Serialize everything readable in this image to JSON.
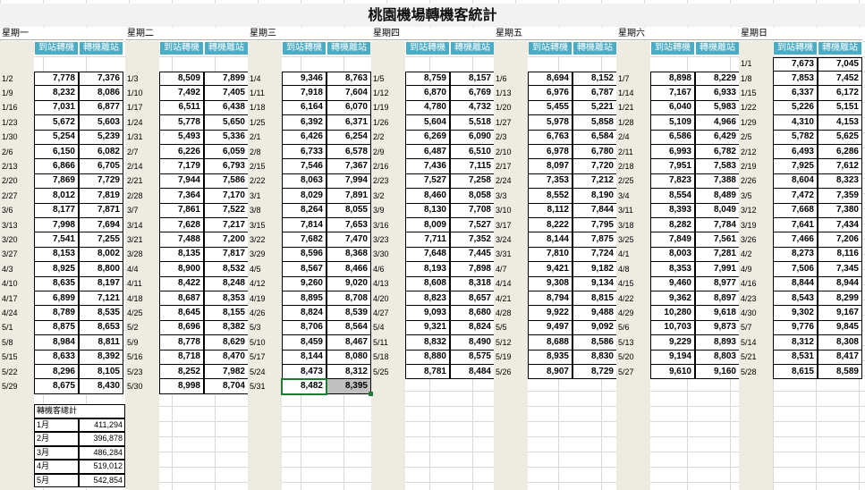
{
  "title": "桃園機場轉機客統計",
  "col_headers": {
    "arrive": "到站轉機",
    "depart": "轉機離站"
  },
  "weekdays": [
    "星期一",
    "星期二",
    "星期三",
    "星期四",
    "星期五",
    "星期六",
    "星期日"
  ],
  "extra_row": {
    "date": "1/1",
    "arrive": "7,673",
    "depart": "7,045"
  },
  "columns": [
    {
      "dates": [
        "1/2",
        "1/9",
        "1/16",
        "1/23",
        "1/30",
        "2/6",
        "2/13",
        "2/20",
        "2/27",
        "3/6",
        "3/13",
        "3/20",
        "3/27",
        "4/3",
        "4/10",
        "4/17",
        "4/24",
        "5/1",
        "5/8",
        "5/15",
        "5/22",
        "5/29"
      ],
      "arrive": [
        "7,778",
        "8,232",
        "7,031",
        "5,672",
        "5,254",
        "6,150",
        "6,866",
        "7,869",
        "8,012",
        "8,177",
        "7,998",
        "7,541",
        "8,153",
        "8,925",
        "8,635",
        "6,899",
        "8,789",
        "8,875",
        "8,984",
        "8,633",
        "8,296",
        "8,675"
      ],
      "depart": [
        "7,376",
        "8,086",
        "6,877",
        "5,603",
        "5,239",
        "6,082",
        "6,705",
        "7,729",
        "7,819",
        "7,871",
        "7,694",
        "7,255",
        "8,002",
        "8,800",
        "8,197",
        "7,121",
        "8,535",
        "8,653",
        "8,811",
        "8,392",
        "8,105",
        "8,430"
      ]
    },
    {
      "dates": [
        "1/3",
        "1/10",
        "1/17",
        "1/24",
        "1/31",
        "2/7",
        "2/14",
        "2/21",
        "2/28",
        "3/7",
        "3/14",
        "3/21",
        "3/28",
        "4/4",
        "4/11",
        "4/18",
        "4/25",
        "5/2",
        "5/9",
        "5/16",
        "5/23",
        "5/30"
      ],
      "arrive": [
        "8,509",
        "7,492",
        "6,511",
        "5,778",
        "5,493",
        "6,226",
        "7,179",
        "7,944",
        "7,364",
        "7,861",
        "7,628",
        "7,488",
        "8,135",
        "8,900",
        "8,422",
        "8,687",
        "8,645",
        "8,696",
        "8,778",
        "8,718",
        "8,252",
        "8,998"
      ],
      "depart": [
        "7,899",
        "7,405",
        "6,438",
        "5,650",
        "5,336",
        "6,059",
        "6,793",
        "7,586",
        "7,170",
        "7,522",
        "7,217",
        "7,200",
        "7,817",
        "8,532",
        "8,248",
        "8,353",
        "8,155",
        "8,382",
        "8,629",
        "8,470",
        "7,982",
        "8,704"
      ]
    },
    {
      "dates": [
        "1/4",
        "1/11",
        "1/18",
        "1/25",
        "2/1",
        "2/8",
        "2/15",
        "2/22",
        "3/1",
        "3/8",
        "3/15",
        "3/22",
        "3/29",
        "4/5",
        "4/12",
        "4/19",
        "4/26",
        "5/3",
        "5/10",
        "5/17",
        "5/24",
        "5/31"
      ],
      "arrive": [
        "9,346",
        "7,918",
        "6,164",
        "6,392",
        "6,426",
        "6,733",
        "7,546",
        "8,063",
        "8,029",
        "8,264",
        "7,814",
        "7,682",
        "8,596",
        "8,567",
        "9,260",
        "8,895",
        "8,824",
        "8,706",
        "8,459",
        "8,144",
        "8,473",
        "8,482"
      ],
      "depart": [
        "8,763",
        "7,604",
        "6,070",
        "6,371",
        "6,254",
        "6,578",
        "7,367",
        "7,994",
        "7,891",
        "8,055",
        "7,653",
        "7,470",
        "8,368",
        "8,466",
        "9,020",
        "8,708",
        "8,539",
        "8,564",
        "8,467",
        "8,080",
        "8,312",
        "8,395"
      ]
    },
    {
      "dates": [
        "1/5",
        "1/12",
        "1/19",
        "1/26",
        "2/2",
        "2/9",
        "2/16",
        "2/23",
        "3/2",
        "3/9",
        "3/16",
        "3/23",
        "3/30",
        "4/6",
        "4/13",
        "4/20",
        "4/27",
        "5/4",
        "5/11",
        "5/18",
        "5/25"
      ],
      "arrive": [
        "8,759",
        "6,870",
        "4,780",
        "5,604",
        "6,269",
        "6,487",
        "7,436",
        "7,527",
        "8,460",
        "8,130",
        "8,009",
        "7,711",
        "7,648",
        "8,193",
        "8,608",
        "8,823",
        "9,093",
        "9,321",
        "8,832",
        "8,880",
        "8,781"
      ],
      "depart": [
        "8,157",
        "6,769",
        "4,732",
        "5,518",
        "6,090",
        "6,510",
        "7,115",
        "7,258",
        "8,058",
        "7,708",
        "7,527",
        "7,352",
        "7,445",
        "7,898",
        "8,318",
        "8,657",
        "8,680",
        "8,824",
        "8,490",
        "8,575",
        "8,484"
      ]
    },
    {
      "dates": [
        "1/6",
        "1/13",
        "1/20",
        "1/27",
        "2/3",
        "2/10",
        "2/17",
        "2/24",
        "3/3",
        "3/10",
        "3/17",
        "3/24",
        "3/31",
        "4/7",
        "4/14",
        "4/21",
        "4/28",
        "5/5",
        "5/12",
        "5/19",
        "5/26"
      ],
      "arrive": [
        "8,694",
        "6,976",
        "5,455",
        "5,978",
        "6,763",
        "6,978",
        "8,097",
        "7,353",
        "8,552",
        "8,112",
        "8,222",
        "8,144",
        "7,810",
        "9,421",
        "9,308",
        "8,794",
        "9,922",
        "9,497",
        "8,688",
        "8,935",
        "8,907"
      ],
      "depart": [
        "8,152",
        "6,787",
        "5,221",
        "5,858",
        "6,584",
        "6,780",
        "7,720",
        "7,212",
        "8,190",
        "7,844",
        "7,795",
        "7,875",
        "7,724",
        "9,182",
        "9,134",
        "8,815",
        "9,488",
        "9,092",
        "8,586",
        "8,830",
        "8,729"
      ]
    },
    {
      "dates": [
        "1/7",
        "1/14",
        "1/21",
        "1/28",
        "2/4",
        "2/11",
        "2/18",
        "2/25",
        "3/4",
        "3/11",
        "3/18",
        "3/25",
        "4/1",
        "4/8",
        "4/15",
        "4/22",
        "4/29",
        "5/6",
        "5/13",
        "5/20",
        "5/27"
      ],
      "arrive": [
        "8,898",
        "7,167",
        "6,040",
        "5,109",
        "6,586",
        "6,993",
        "7,951",
        "7,823",
        "8,554",
        "8,393",
        "8,282",
        "7,849",
        "8,003",
        "8,353",
        "9,460",
        "9,362",
        "10,280",
        "10,703",
        "9,229",
        "9,194",
        "9,610"
      ],
      "depart": [
        "8,229",
        "6,933",
        "5,983",
        "4,966",
        "6,429",
        "6,782",
        "7,583",
        "7,388",
        "8,489",
        "8,049",
        "7,784",
        "7,561",
        "7,281",
        "7,991",
        "8,977",
        "8,897",
        "9,618",
        "9,873",
        "8,893",
        "8,803",
        "9,160"
      ]
    },
    {
      "dates": [
        "1/8",
        "1/15",
        "1/22",
        "1/29",
        "2/5",
        "2/12",
        "2/19",
        "2/26",
        "3/5",
        "3/12",
        "3/19",
        "3/26",
        "4/2",
        "4/9",
        "4/16",
        "4/23",
        "4/30",
        "5/7",
        "5/14",
        "5/21",
        "5/28"
      ],
      "arrive": [
        "7,853",
        "6,337",
        "5,226",
        "4,310",
        "5,782",
        "6,493",
        "7,925",
        "8,604",
        "7,472",
        "7,668",
        "7,641",
        "7,466",
        "8,273",
        "7,506",
        "8,844",
        "8,543",
        "9,302",
        "9,776",
        "8,312",
        "8,531",
        "8,615"
      ],
      "depart": [
        "7,452",
        "6,172",
        "5,151",
        "4,153",
        "5,625",
        "6,286",
        "7,612",
        "8,323",
        "7,359",
        "7,380",
        "7,434",
        "7,206",
        "8,116",
        "7,345",
        "8,944",
        "8,299",
        "9,167",
        "9,845",
        "8,308",
        "8,417",
        "8,589"
      ]
    }
  ],
  "summary": {
    "title": "轉機客總計",
    "rows": [
      {
        "month": "1月",
        "value": "411,294"
      },
      {
        "month": "2月",
        "value": "396,878"
      },
      {
        "month": "3月",
        "value": "486,284"
      },
      {
        "month": "4月",
        "value": "519,012"
      },
      {
        "month": "5月",
        "value": "542,854"
      }
    ]
  }
}
